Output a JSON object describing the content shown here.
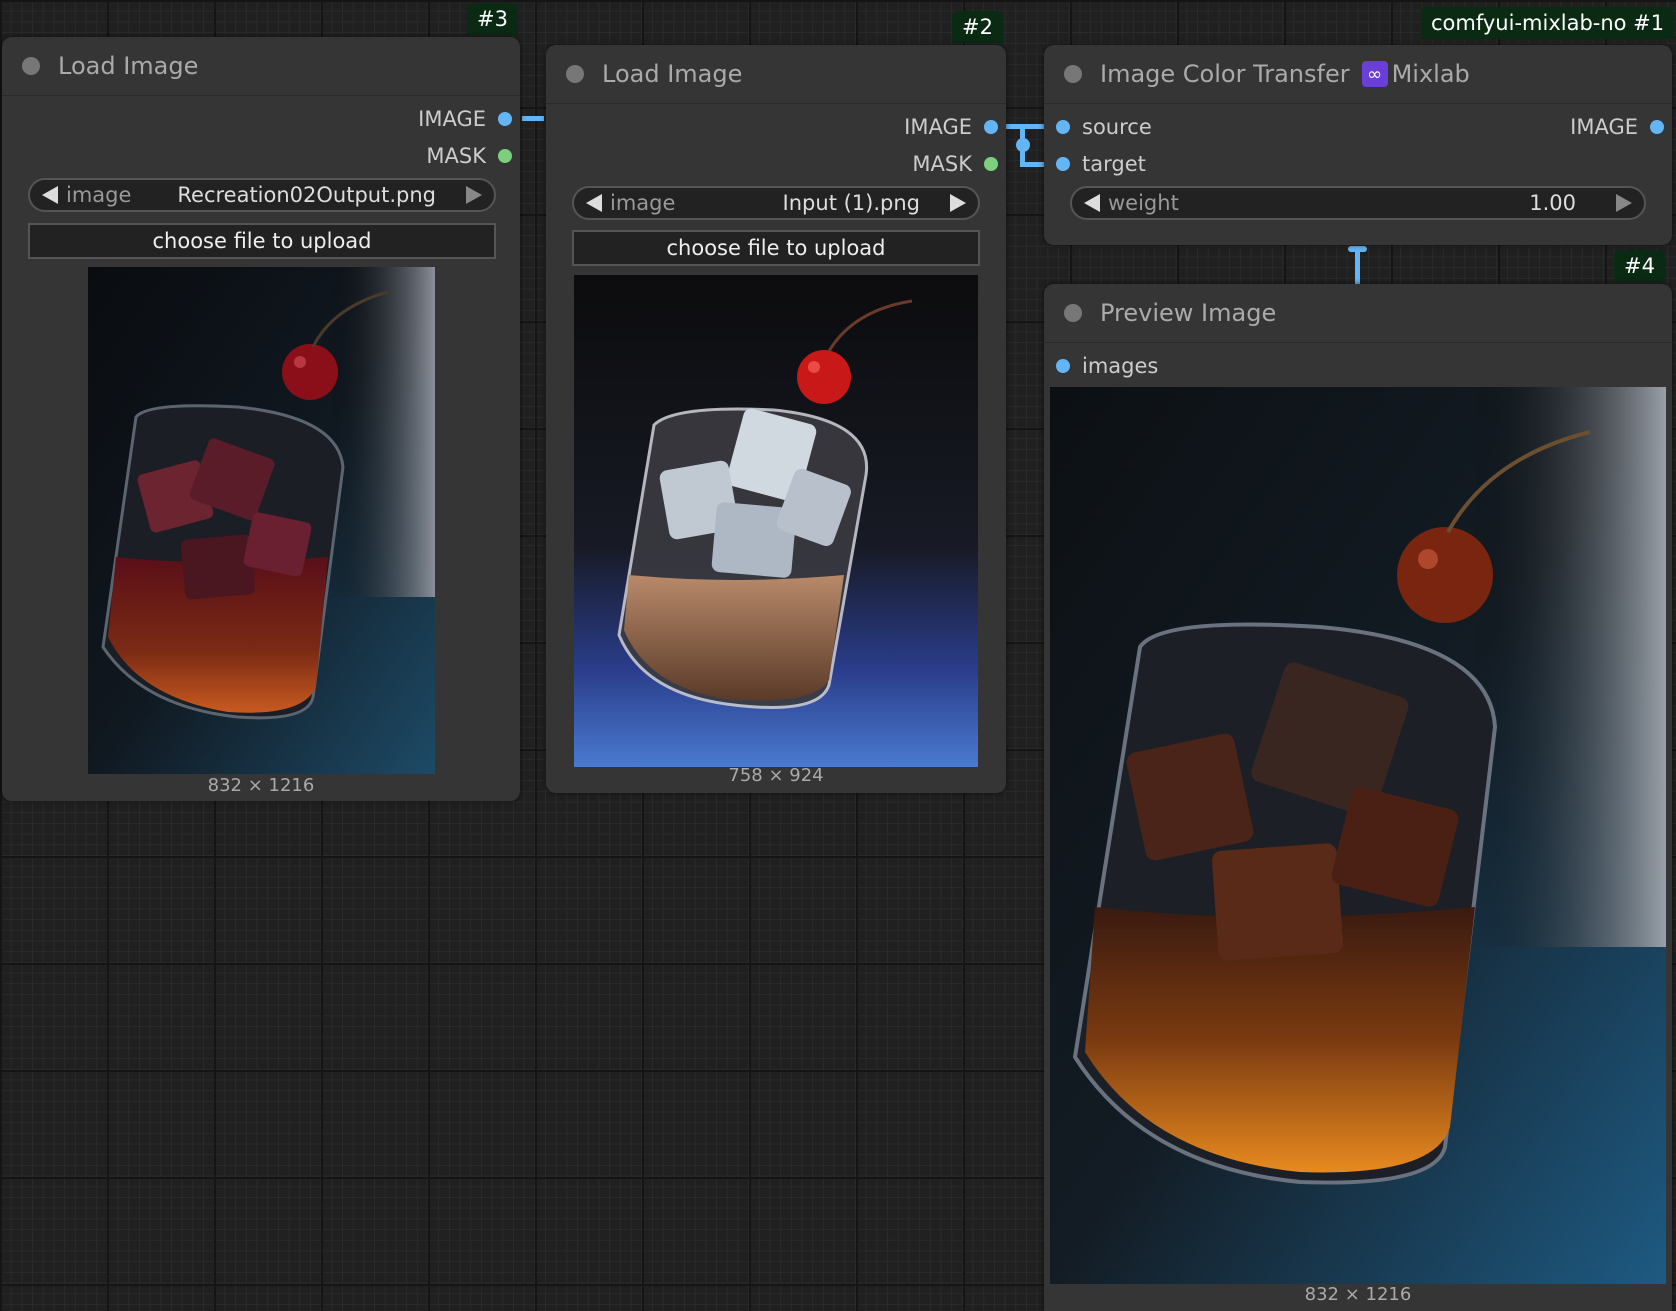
{
  "nodes": {
    "load_image_3": {
      "badge": "#3",
      "title": "Load Image",
      "outputs": [
        "IMAGE",
        "MASK"
      ],
      "widget": {
        "name": "image",
        "value": "Recreation02Output.png"
      },
      "upload_label": "choose file to upload",
      "dimensions": "832 × 1216"
    },
    "load_image_2": {
      "badge": "#2",
      "title": "Load Image",
      "outputs": [
        "IMAGE",
        "MASK"
      ],
      "widget": {
        "name": "image",
        "value": "Input (1).png"
      },
      "upload_label": "choose file to upload",
      "dimensions": "758 × 924"
    },
    "color_transfer_1": {
      "badge": "comfyui-mixlab-no  #1",
      "title": "Image Color Transfer",
      "title_suffix": "Mixlab",
      "inputs": [
        "source",
        "target"
      ],
      "outputs": [
        "IMAGE"
      ],
      "widget": {
        "name": "weight",
        "value": "1.00"
      }
    },
    "preview_4": {
      "badge": "#4",
      "title": "Preview Image",
      "inputs": [
        "images"
      ],
      "dimensions": "832 × 1216"
    }
  },
  "colors": {
    "image_socket": "#64b5f6",
    "mask_socket": "#7ccf7c",
    "badge_bg": "#0b2a14",
    "node_bg": "#353535"
  },
  "icons": [
    "collapse-dot-icon",
    "arrow-left-icon",
    "arrow-right-icon",
    "mixlab-infinity-icon"
  ]
}
